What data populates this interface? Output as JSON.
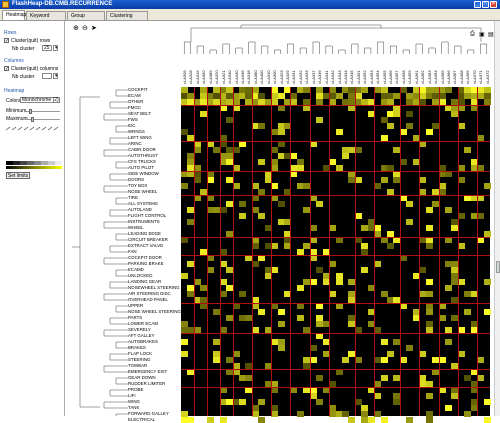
{
  "window": {
    "title": "FlashHeap-DB.CMB.RECURRENCE"
  },
  "tabs": [
    "Heatmap",
    "Keyword Dendrogram",
    "Group Dendrogram",
    "Clustering Statistics"
  ],
  "left_panel": {
    "rows_header": "Rows",
    "rows_cluster_label": "Cluster(quit) rows",
    "rows_nb_label": "Nb cluster",
    "rows_nb_value": "25",
    "cols_header": "Columns",
    "cols_cluster_label": "Cluster(quit) columns",
    "cols_nb_label": "Nb cluster",
    "heatmap_header": "Heatmap",
    "colors_label": "Colors",
    "colors_value": "Monochrome (2)",
    "minimum_label": "Minimum",
    "maximum_label": "Maximum",
    "set_limits": "Set limits"
  },
  "row_labels": [
    "COCKPIT",
    "ECAM",
    "OTHER",
    "FMGC",
    "SEAT BELT",
    "FWS",
    "IDC",
    "WRNGS",
    "LEFT WING",
    "ARINC",
    "CABIN DOOR",
    "AUTOTHRUST",
    "CFS TRUCKS",
    "AUTO PILOT",
    "SIDE WINDOW",
    "DOORS",
    "TOY BOX",
    "NOSE WHEEL",
    "TIRE",
    "ALL SYSTEMS",
    "AUTOLAND",
    "FLIGHT CONTROL",
    "INSTRUMENTS",
    "WHEEL",
    "LEADING EDGE",
    "CIRCUIT BREAKER",
    "EXTRACT VALVE",
    "FAN",
    "COCKPIT DOOR",
    "PARKING BRAKE",
    "ECAMD",
    "UNLOCKED",
    "LANDING GEAR",
    "NOSEWHEEL STEERING",
    "AIR STEERING DISC",
    "OVERHEAD PANEL",
    "UPPER",
    "NOSE WHEEL STEERING",
    "PARTS",
    "LOWER ECAM",
    "SEVERELY",
    "AFT GALLEY",
    "AUTOBRAKES",
    "BRAKES",
    "FLAP LOCK",
    "STEERING",
    "TOWBAR",
    "EMERGENCY EXIT",
    "GEAR DOWN",
    "RUDDER LIMITER",
    "PROBE",
    "LIFI",
    "WING",
    "TANK",
    "FORWARD GALLEY",
    "ELECTRICAL"
  ],
  "col_labels": [
    "cl-A309",
    "cl-A328",
    "cl-A319",
    "cl-A350",
    "cl-A389",
    "cl-A320",
    "cl-A321",
    "cl-A330",
    "cl-A340",
    "cl-A346",
    "cl-A318",
    "cl-A380",
    "cl-A400",
    "cl-A310",
    "cl-A300",
    "cl-A323",
    "cl-A329",
    "cl-A331",
    "cl-A332",
    "cl-A333",
    "cl-A337",
    "cl-A339",
    "cl-A341",
    "cl-A342",
    "cl-A343",
    "cl-A344",
    "cl-A345",
    "cl-A351",
    "cl-A352",
    "cl-A353",
    "cl-A354",
    "cl-A355",
    "cl-A356",
    "cl-A357",
    "cl-A358",
    "cl-A359",
    "cl-A361",
    "cl-A362",
    "cl-A363",
    "cl-A364",
    "cl-A365",
    "cl-A366",
    "cl-A367",
    "cl-A368",
    "cl-A369",
    "cl-A370",
    "cl-A371",
    "cl-A372"
  ],
  "colors": {
    "heat_low": "#000000",
    "heat_high": "#ffff00",
    "grid": "#b01010",
    "titlebar": "#0a3ca8"
  }
}
